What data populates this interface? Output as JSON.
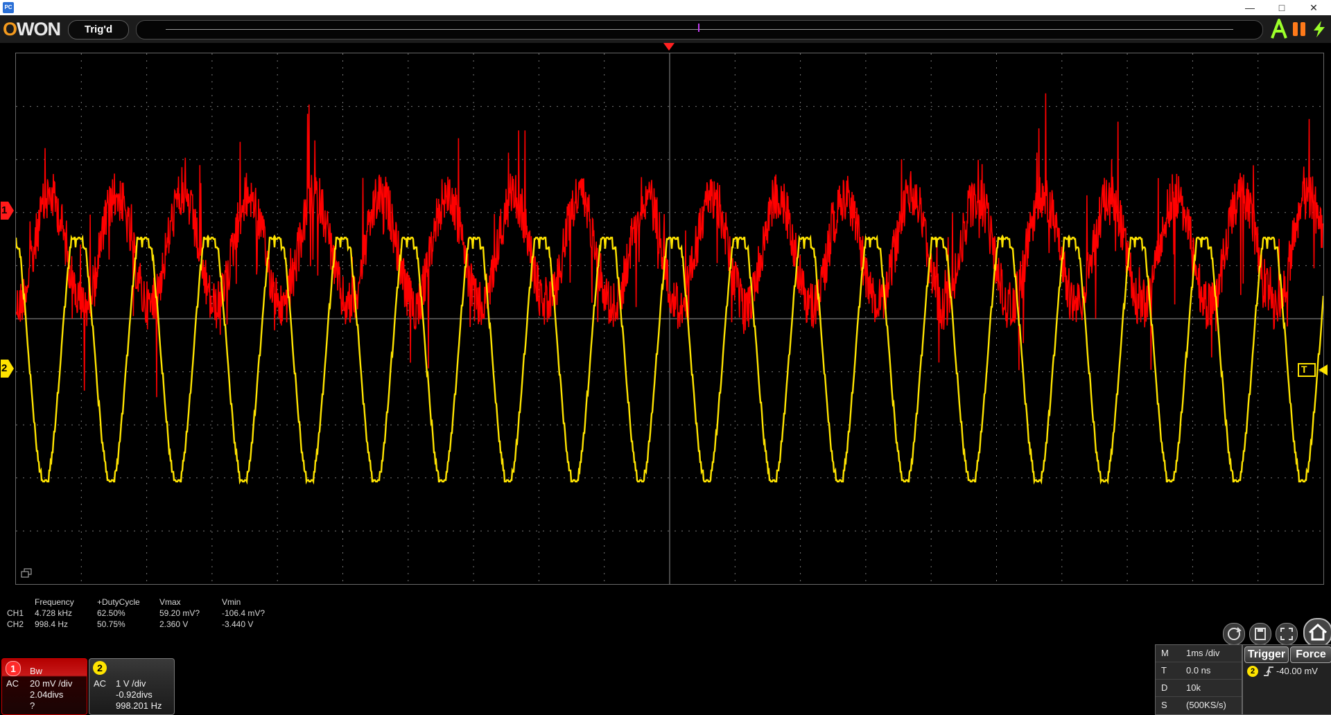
{
  "app": {
    "icon_text": "PC",
    "window_buttons": {
      "minimize": "—",
      "maximize": "□",
      "close": "✕"
    }
  },
  "toolbar": {
    "logo_o": "O",
    "logo_rest": "WON",
    "trigger_status": "Trig'd",
    "icons": [
      "auto-icon",
      "run-stop-icon",
      "force-trigger-icon"
    ]
  },
  "colors": {
    "ch1": "#ff0000",
    "ch2": "#ffe400",
    "grid": "#7a7a7a",
    "trigger_marker": "#ff2020"
  },
  "display": {
    "ch1_marker": "1",
    "ch2_marker": "2",
    "trigger_level_marker": "T"
  },
  "measurements": {
    "headers": [
      "Frequency",
      "+DutyCycle",
      "Vmax",
      "Vmin"
    ],
    "rows": [
      {
        "channel": "CH1",
        "values": [
          "4.728 kHz",
          "62.50%",
          "59.20 mV?",
          "-106.4 mV?"
        ]
      },
      {
        "channel": "CH2",
        "values": [
          "998.4 Hz",
          "50.75%",
          "2.360 V",
          "-3.440 V"
        ]
      }
    ]
  },
  "ch1": {
    "badge": "1",
    "bw": "Bw",
    "coupling": "AC",
    "scale": "20 mV /div",
    "offset": "2.04divs",
    "freq": "?"
  },
  "ch2": {
    "badge": "2",
    "coupling": "AC",
    "scale": "1 V /div",
    "offset": "-0.92divs",
    "freq": "998.201 Hz"
  },
  "bottom_icons": [
    "refresh-icon",
    "save-icon",
    "fit-screen-icon",
    "home-icon"
  ],
  "timebase": {
    "rows": [
      {
        "key": "M",
        "value": "1ms /div"
      },
      {
        "key": "T",
        "value": "0.0 ns"
      },
      {
        "key": "D",
        "value": "10k"
      },
      {
        "key": "S",
        "value": "(500KS/s)"
      }
    ]
  },
  "trigger": {
    "trigger_label": "Trigger",
    "force_label": "Force",
    "source": "2",
    "slope_icon": "rising-edge-icon",
    "level": "-40.00 mV"
  }
}
